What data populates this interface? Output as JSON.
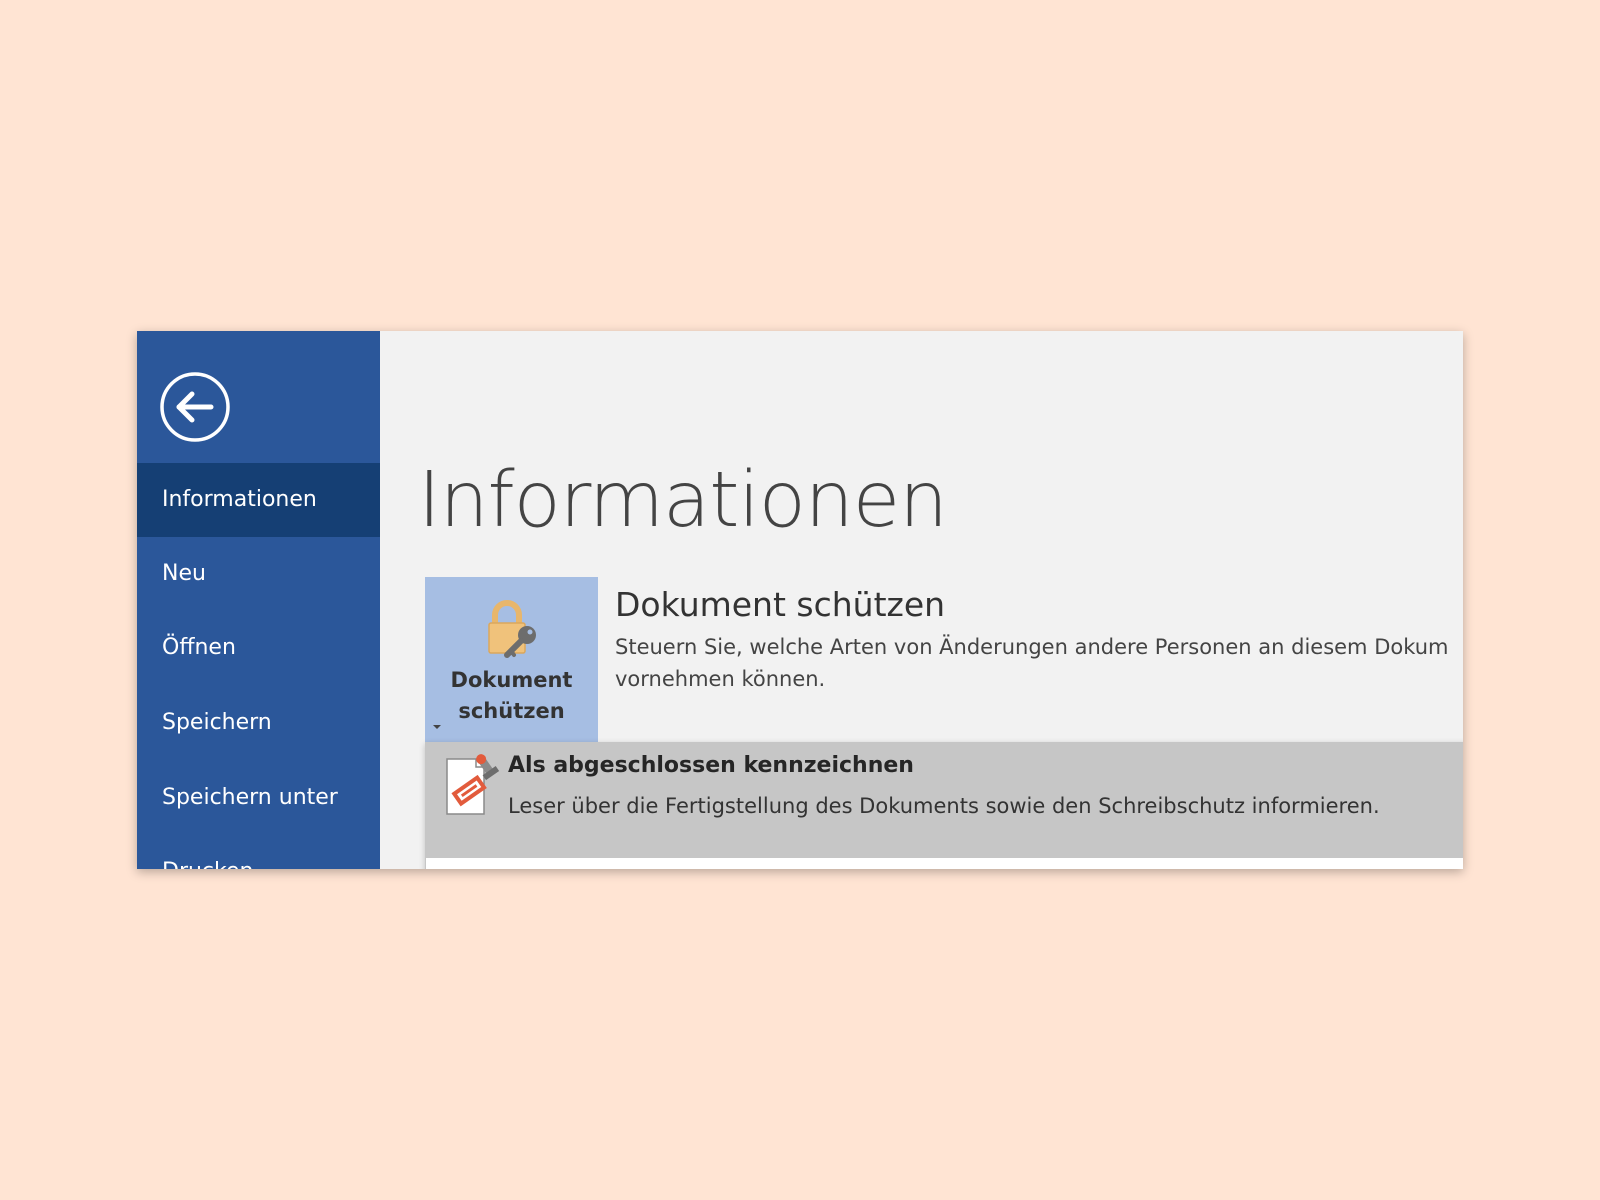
{
  "sidebar": {
    "items": [
      {
        "label": "Informationen",
        "active": true
      },
      {
        "label": "Neu"
      },
      {
        "label": "Öffnen"
      },
      {
        "label": "Speichern"
      },
      {
        "label": "Speichern unter"
      },
      {
        "label": "Drucken"
      }
    ]
  },
  "main": {
    "title": "Informationen",
    "protect_button": {
      "line1": "Dokument",
      "line2": "schützen"
    },
    "section": {
      "heading": "Dokument schützen",
      "description_line1": "Steuern Sie, welche Arten von Änderungen andere Personen an diesem Dokum",
      "description_line2": "vornehmen können."
    }
  },
  "dropdown": {
    "items": [
      {
        "title": "Als abgeschlossen kennzeichnen",
        "description": "Leser über die Fertigstellung des Dokuments sowie den Schreibschutz informieren."
      }
    ]
  },
  "colors": {
    "page_background": "#ffe4d3",
    "sidebar": "#2b579a",
    "sidebar_active": "#153f74",
    "protect_button": "#a6bee3",
    "menu_item_hover": "#c6c6c6"
  }
}
